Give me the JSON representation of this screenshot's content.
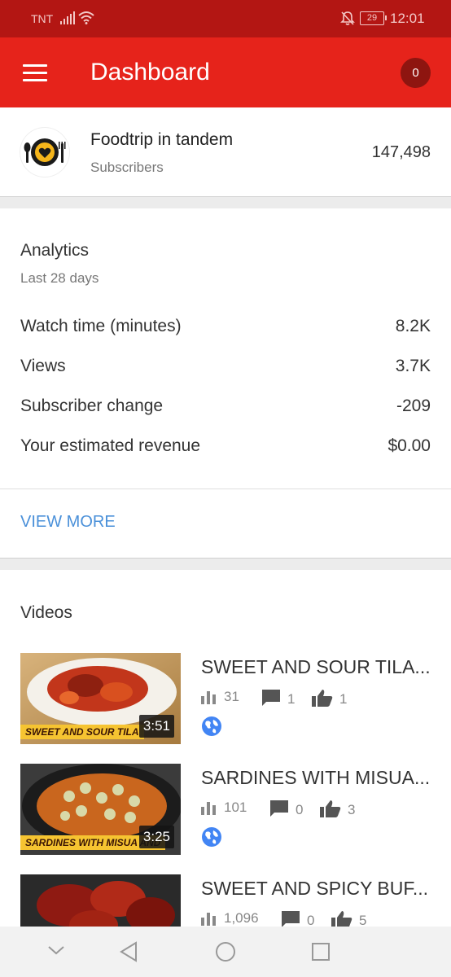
{
  "status_bar": {
    "carrier": "TNT",
    "battery": "29",
    "time": "12:01"
  },
  "app_bar": {
    "title": "Dashboard",
    "notification_count": "0"
  },
  "channel": {
    "name": "Foodtrip in tandem",
    "subscribers_label": "Subscribers",
    "subscribers_count": "147,498"
  },
  "analytics": {
    "title": "Analytics",
    "period": "Last 28 days",
    "metrics": [
      {
        "label": "Watch time (minutes)",
        "value": "8.2K"
      },
      {
        "label": "Views",
        "value": "3.7K"
      },
      {
        "label": "Subscriber change",
        "value": "-209"
      },
      {
        "label": "Your estimated revenue",
        "value": "$0.00"
      }
    ],
    "view_more": "VIEW MORE"
  },
  "videos": {
    "title": "Videos",
    "items": [
      {
        "title": "SWEET AND SOUR TILA...",
        "thumb_text": "SWEET AND SOUR TILA",
        "duration": "3:51",
        "views": "31",
        "comments": "1",
        "likes": "1"
      },
      {
        "title": "SARDINES WITH MISUA...",
        "thumb_text": "SARDINES WITH MISUA AND",
        "duration": "3:25",
        "views": "101",
        "comments": "0",
        "likes": "3"
      },
      {
        "title": "SWEET AND SPICY BUF...",
        "thumb_text": "",
        "duration": "",
        "views": "1,096",
        "comments": "0",
        "likes": "5"
      }
    ]
  },
  "colors": {
    "app_bar": "#e6231b",
    "status_bar": "#b31613",
    "link": "#4a90d9",
    "globe": "#4285f4"
  },
  "icons": [
    "menu-icon",
    "signal-icon",
    "wifi-icon",
    "bell-off-icon",
    "bar-chart-icon",
    "comment-icon",
    "thumbs-up-icon",
    "globe-icon",
    "chevron-down-icon",
    "back-icon",
    "home-icon",
    "recents-icon"
  ]
}
